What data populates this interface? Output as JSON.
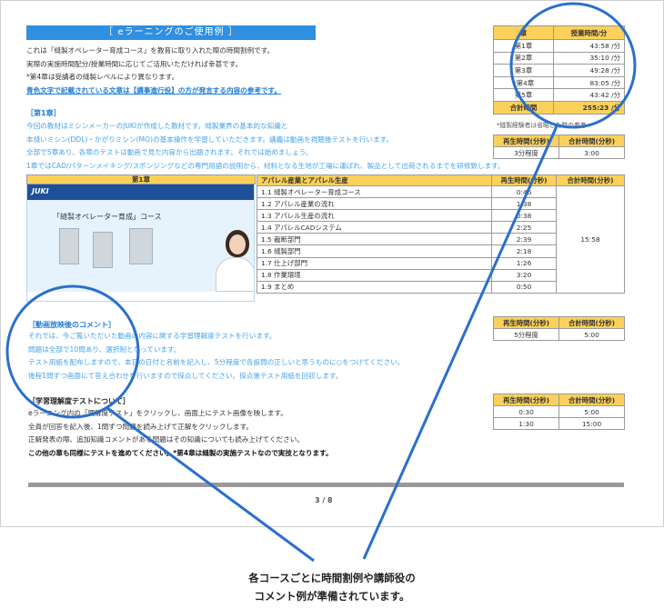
{
  "doc": {
    "title": "［ eラーニングのご使用例 ］",
    "intro_lines": [
      "これは「縫製オペレーター育成コース」を教育に取り入れた際の時間割例です。",
      "実際の実施時間配分/授業時間に応じてご活用いただければ幸甚です。",
      "*第4章は受講者の縫製レベルにより異なります。"
    ],
    "intro_highlight": "青色文字で記載されている文章は【講事進行役】の方が発言する内容の参考です。",
    "section1_head": "［第1章］",
    "section1_lines": [
      "今回の教材はミシンメーカーのJUKIが作成した教材です。縫製業界の基本的な知識と",
      "本縫いミシン(DDL)・かがりミシン(MO)の基本操作を学習していただきます。講義は動画を視聴後テストを行います。",
      "全部で5章あり、各章のテストは動画で見た内容から出題されます。それでは始めましょう。",
      "1章ではCAD/パターンメイキング/スポンジングなどの専門用語の説明から、材料となる生地が工場に運ばれ、製品として出荷されるまでを研修致します。"
    ],
    "section2_head": "［動画放映後のコメント］",
    "section2_lines": [
      "それでは、今ご覧いただいた動画の内容に関する学習理解度テストを行います。",
      "問題は全部で10問あり、選択制となっています。",
      "テスト用紙を配布しますので、本日の日付と名前を記入し、5分程度で各設問の正しいと思うものに○をつけてください。",
      "後程1問ずつ画面にて答え合わせを行いますので採点してください。採点後テスト用紙を回収します。"
    ],
    "section3_head": "［学習理解度テストについて］",
    "section3_lines": [
      "eラーニング内の「理解度テスト」をクリックし、画面上にテスト画像を映します。",
      "全員が回答を記入後、1問ずつ問題を読み上げて正解をクリックします。",
      "正解発表の際、追加知識コメントがある問題はその知識についても読み上げてください。"
    ],
    "section3_bold": "この他の章も同様にテストを進めてください。*第4章は縫製の実施テストなので実技となります。",
    "page_number": "3 / 8"
  },
  "chapter_table": {
    "headers": [
      "章",
      "授業時間/分"
    ],
    "rows": [
      {
        "chap": "第1章",
        "time": "43:58 /分"
      },
      {
        "chap": "第2章",
        "time": "35:10 /分"
      },
      {
        "chap": "第3章",
        "time": "49:28 /分"
      },
      {
        "chap": "*第4章",
        "time": "83:05 /分"
      },
      {
        "chap": "第5章",
        "time": "43:42 /分"
      }
    ],
    "total_label": "合計時間",
    "total_value": "255:23 /分",
    "note": "*縫製経験者は省略した時の参考"
  },
  "time_headers": [
    "再生時間(分秒)",
    "合計時間(分秒)"
  ],
  "time_table_1": {
    "play": "3分程度",
    "total": "3:00"
  },
  "time_table_2": {
    "play": "5分程度",
    "total": "5:00"
  },
  "time_table_3": {
    "rows": [
      {
        "play": "0:30",
        "total": "5:00"
      },
      {
        "play": "1:30",
        "total": "15:00"
      }
    ]
  },
  "main_table": {
    "headers": [
      "第1章",
      "アパレル産業とアパレル生産",
      "再生時間(分秒)",
      "合計時間(分秒)"
    ],
    "rows": [
      {
        "label": "1.1 縫製オペレーター育成コース",
        "time": "0:46"
      },
      {
        "label": "1.2 アパレル産業の流れ",
        "time": "1:38"
      },
      {
        "label": "1.3 アパレル生産の流れ",
        "time": "0:38"
      },
      {
        "label": "1.4 アパレルCADシステム",
        "time": "2:25"
      },
      {
        "label": "1.5 裁断部門",
        "time": "2:39"
      },
      {
        "label": "1.6 縫製部門",
        "time": "2:18"
      },
      {
        "label": "1.7 仕上げ部門",
        "time": "1:26"
      },
      {
        "label": "1.8 作業環境",
        "time": "3:20"
      },
      {
        "label": "1.9 まとめ",
        "time": "0:50"
      }
    ],
    "total": "15:58"
  },
  "slide": {
    "logo": "JUKI",
    "title": "「縫製オペレーター育成」コース"
  },
  "caption": {
    "line1": "各コースごとに時間割例や講師役の",
    "line2": "コメント例が準備されています。"
  },
  "colors": {
    "accent_blue": "#2f8fe0",
    "header_yellow": "#fbd15b",
    "circle_blue": "#2a6fcc"
  }
}
